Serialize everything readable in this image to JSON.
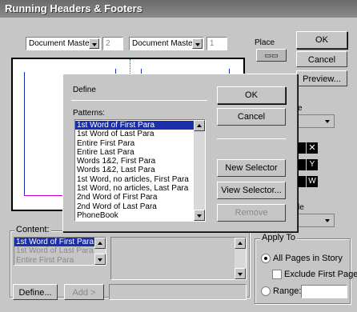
{
  "window": {
    "title": "Running Headers & Footers"
  },
  "main": {
    "master1": "Document Master",
    "master1_num": "2",
    "master2": "Document Master",
    "master2_num": "1",
    "place_label": "Place",
    "ok_label": "OK",
    "cancel_label": "Cancel",
    "preview_label": "Preview...",
    "style_label": "e",
    "style2_label": "le",
    "content_label": "Content:",
    "content_items": [
      "1st Word of First Para",
      "1st Word of Last Para",
      "Entire First Para"
    ],
    "define_label": "Define...",
    "add_label": "Add >",
    "apply_to_label": "Apply To",
    "apply_options": {
      "all_pages": "All Pages in Story",
      "exclude_first": "Exclude First Page",
      "range": "Range:"
    }
  },
  "define_dialog": {
    "title": "Define",
    "patterns_label": "Patterns:",
    "patterns": [
      "1st Word of First Para",
      "1st Word of Last Para",
      "Entire First Para",
      "Entire Last Para",
      "Words 1&2, First Para",
      "Words 1&2, Last Para",
      "1st Word, no articles, First Para",
      "1st Word, no articles, Last Para",
      "2nd Word of First Para",
      "2nd Word of Last Para",
      "PhoneBook"
    ],
    "selected_index": 0,
    "ok_label": "OK",
    "cancel_label": "Cancel",
    "new_selector_label": "New Selector",
    "view_selector_label": "View Selector...",
    "remove_label": "Remove"
  },
  "colors": {
    "selection": "#1a2fa8",
    "guide_blue": "#1a2fa8",
    "guide_magenta": "#d000d0",
    "guide_green": "#00a000"
  }
}
